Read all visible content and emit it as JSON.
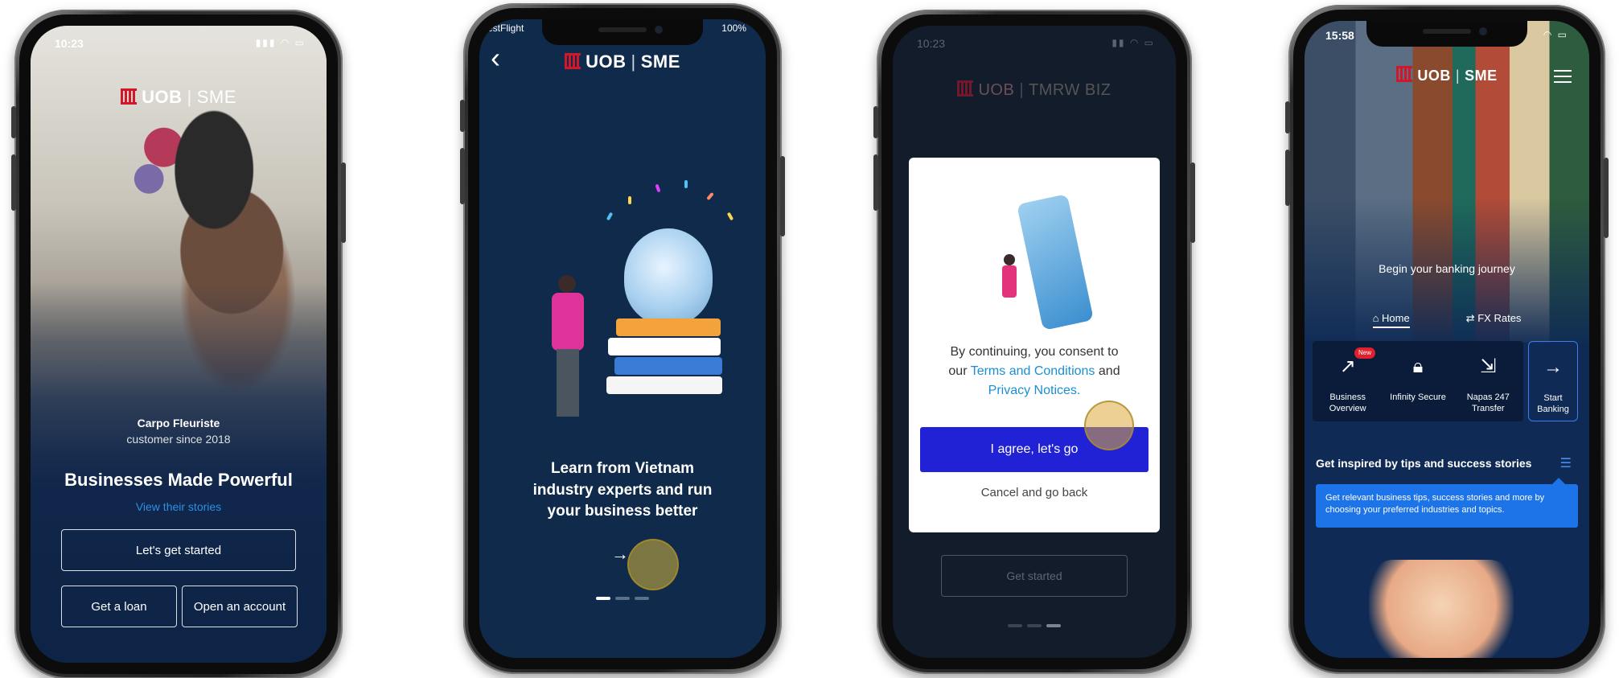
{
  "phone1": {
    "status_time": "10:23",
    "status_icons": "▮▮▮ ◠ ▭",
    "logo_brand": "UOB",
    "logo_product": "SME",
    "caption_name": "Carpo Fleuriste",
    "caption_since": "customer since 2018",
    "headline": "Businesses Made Powerful",
    "stories_link": "View their stories",
    "primary_button": "Let's get started",
    "loan_button": "Get a loan",
    "account_button": "Open an account"
  },
  "phone2": {
    "status_left": "estFlight",
    "status_right": "100%",
    "back_icon": "‹",
    "logo_brand": "UOB",
    "logo_product": "SME",
    "message": "Learn from Vietnam industry experts and run your business better",
    "next_icon": "→"
  },
  "phone3": {
    "status_time": "10:23",
    "status_icons": "▮▮ ◠ ▭",
    "logo_brand": "UOB",
    "logo_product": "TMRW BIZ",
    "consent_prefix": "By continuing, you consent to",
    "consent_our": "our",
    "terms_link": "Terms and Conditions",
    "consent_and": "and",
    "privacy_link": "Privacy Notices.",
    "agree_button": "I agree, let's go",
    "cancel_button": "Cancel and go back",
    "get_started_button": "Get started"
  },
  "phone4": {
    "status_time": "15:58",
    "status_icons": "◠ ▭",
    "logo_brand": "UOB",
    "logo_product": "SME",
    "banner_text": "Begin your banking journey",
    "tab_home": "Home",
    "tab_fx": "FX Rates",
    "quick_actions": [
      {
        "label": "Business Overview",
        "icon": "↗",
        "badge": "New"
      },
      {
        "label": "Infinity Secure",
        "icon": "🔒︎"
      },
      {
        "label": "Napas 247 Transfer",
        "icon": "⇲"
      }
    ],
    "start_banking": "Start Banking",
    "start_icon": "→",
    "tips_title": "Get inspired by tips and success stories",
    "tooltip": "Get relevant business tips, success stories and more by choosing your preferred industries and topics."
  }
}
